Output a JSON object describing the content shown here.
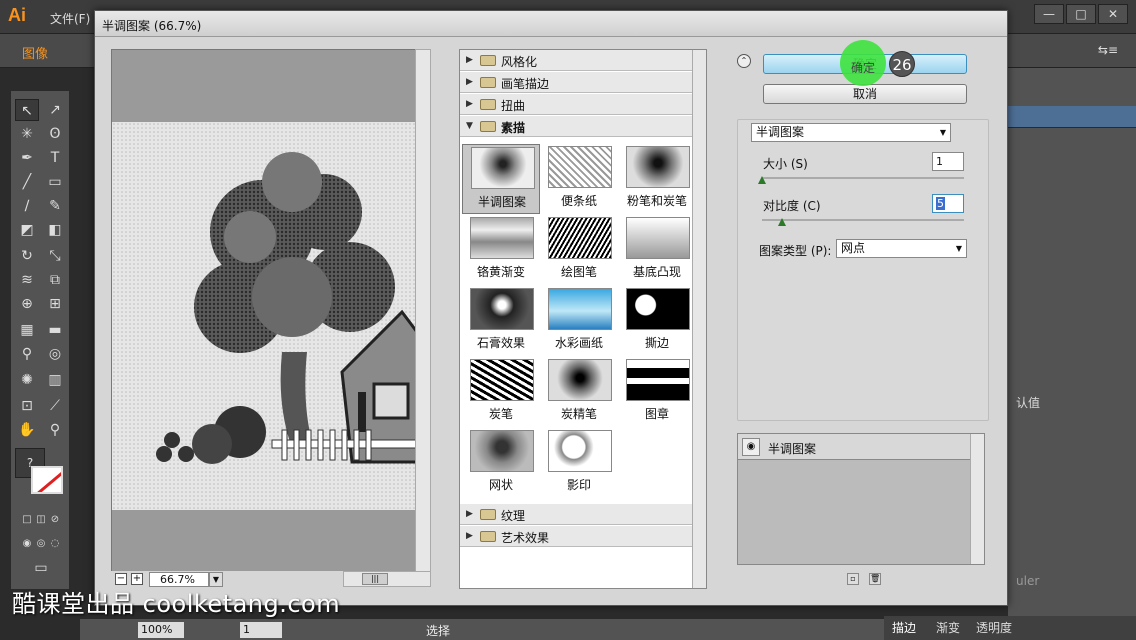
{
  "app": {
    "logo_text": "Ai",
    "menu_file": "文件(F)",
    "window_controls": [
      "—",
      "□",
      "✕"
    ],
    "control_label": "图像",
    "statusbar": {
      "zoom": "100%",
      "page": "1",
      "mode": "选择"
    },
    "bottom_tabs": [
      "描边",
      "渐变",
      "透明度"
    ],
    "right_panel_text": "认值",
    "right_panel_text2": "uler"
  },
  "dialog": {
    "title": "半调图案 (66.7%)",
    "zoom_value": "66.7%",
    "categories_top": [
      {
        "label": "风格化",
        "expanded": false
      },
      {
        "label": "画笔描边",
        "expanded": false
      },
      {
        "label": "扭曲",
        "expanded": false
      },
      {
        "label": "素描",
        "expanded": true
      }
    ],
    "categories_bottom": [
      {
        "label": "纹理",
        "expanded": false
      },
      {
        "label": "艺术效果",
        "expanded": false
      }
    ],
    "filters": [
      {
        "label": "半调图案",
        "selected": true
      },
      {
        "label": "便条纸",
        "selected": false
      },
      {
        "label": "粉笔和炭笔",
        "selected": false
      },
      {
        "label": "铬黄渐变",
        "selected": false
      },
      {
        "label": "绘图笔",
        "selected": false
      },
      {
        "label": "基底凸现",
        "selected": false
      },
      {
        "label": "石膏效果",
        "selected": false
      },
      {
        "label": "水彩画纸",
        "selected": false
      },
      {
        "label": "撕边",
        "selected": false
      },
      {
        "label": "炭笔",
        "selected": false
      },
      {
        "label": "炭精笔",
        "selected": false
      },
      {
        "label": "图章",
        "selected": false
      },
      {
        "label": "网状",
        "selected": false
      },
      {
        "label": "影印",
        "selected": false
      }
    ],
    "ok_label": "确定",
    "cancel_label": "取消",
    "step_badge": "26",
    "filter_select": "半调图案",
    "params": {
      "size_label": "大小 (S)",
      "size_value": "1",
      "size_fraction": 0.0,
      "contrast_label": "对比度 (C)",
      "contrast_value": "5",
      "contrast_fraction": 0.1,
      "pattern_label": "图案类型 (P):",
      "pattern_value": "网点"
    },
    "layer_label": "半调图案"
  },
  "watermark": "酷课堂出品 coolketang.com"
}
